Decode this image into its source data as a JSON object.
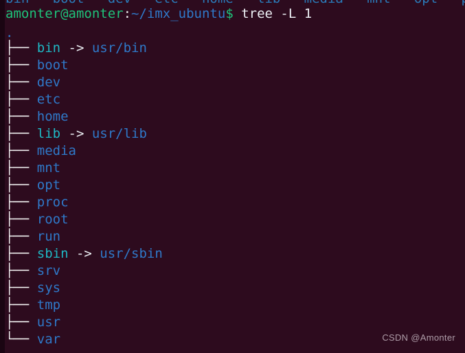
{
  "terminal": {
    "background_color": "#2d0b1e",
    "scrollback_line": "bin   boot   dev   etc   home   lib   media   mnt   opt   proc",
    "prompt": {
      "user_host": "amonter@amonter",
      "separator": ":",
      "path": "~/imx_ubuntu",
      "symbol": "$",
      "command": " tree -L 1"
    },
    "tree": {
      "root": ".",
      "branch_mid": "├── ",
      "branch_last": "└── ",
      "arrow": " -> ",
      "entries": [
        {
          "name": "bin",
          "type": "symlink",
          "target": "usr/bin",
          "last": false
        },
        {
          "name": "boot",
          "type": "directory",
          "target": "",
          "last": false
        },
        {
          "name": "dev",
          "type": "directory",
          "target": "",
          "last": false
        },
        {
          "name": "etc",
          "type": "directory",
          "target": "",
          "last": false
        },
        {
          "name": "home",
          "type": "directory",
          "target": "",
          "last": false
        },
        {
          "name": "lib",
          "type": "symlink",
          "target": "usr/lib",
          "last": false
        },
        {
          "name": "media",
          "type": "directory",
          "target": "",
          "last": false
        },
        {
          "name": "mnt",
          "type": "directory",
          "target": "",
          "last": false
        },
        {
          "name": "opt",
          "type": "directory",
          "target": "",
          "last": false
        },
        {
          "name": "proc",
          "type": "directory",
          "target": "",
          "last": false
        },
        {
          "name": "root",
          "type": "directory",
          "target": "",
          "last": false
        },
        {
          "name": "run",
          "type": "directory",
          "target": "",
          "last": false
        },
        {
          "name": "sbin",
          "type": "symlink",
          "target": "usr/sbin",
          "last": false
        },
        {
          "name": "srv",
          "type": "directory",
          "target": "",
          "last": false
        },
        {
          "name": "sys",
          "type": "directory",
          "target": "",
          "last": false
        },
        {
          "name": "tmp",
          "type": "directory",
          "target": "",
          "last": false
        },
        {
          "name": "usr",
          "type": "directory",
          "target": "",
          "last": false
        },
        {
          "name": "var",
          "type": "directory",
          "target": "",
          "last": true
        }
      ]
    },
    "colors": {
      "directory": "#2f79c9",
      "symlink": "#1fb8c4",
      "user_host": "#1ec27a",
      "command": "#eceff4",
      "branch": "#f2f2f2"
    }
  },
  "watermark": {
    "text": "CSDN @Amonter"
  }
}
